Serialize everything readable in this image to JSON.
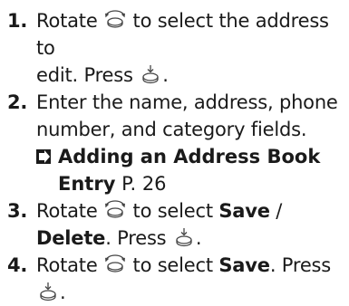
{
  "steps": [
    {
      "number": "1.",
      "line1_prefix": "Rotate",
      "line1_suffix": "to select the address to",
      "line2_prefix": "edit. Press",
      "line2_suffix": "."
    },
    {
      "number": "2.",
      "line1": "Enter the name, address, phone",
      "line2": "number, and category fields."
    },
    {
      "number": "3.",
      "line1_prefix": "Rotate",
      "line1_suffix": "to select",
      "line1_bold": "Save",
      "line1_tail": " /",
      "line2_bold": "Delete",
      "line2_middle": ". Press",
      "line2_suffix": "."
    },
    {
      "number": "4.",
      "line1_prefix": "Rotate",
      "line1_suffix": "to select",
      "line1_bold": "Save",
      "line1_tail": ". Press",
      "line2_suffix": "."
    }
  ],
  "reference": {
    "title_line1": "Adding an Address Book",
    "title_line2": "Entry",
    "page": "P. 26"
  },
  "icons": {
    "knob": "interface-dial-rotate-icon",
    "press": "interface-dial-press-icon",
    "ref_arrow": "cross-reference-arrow-icon"
  }
}
